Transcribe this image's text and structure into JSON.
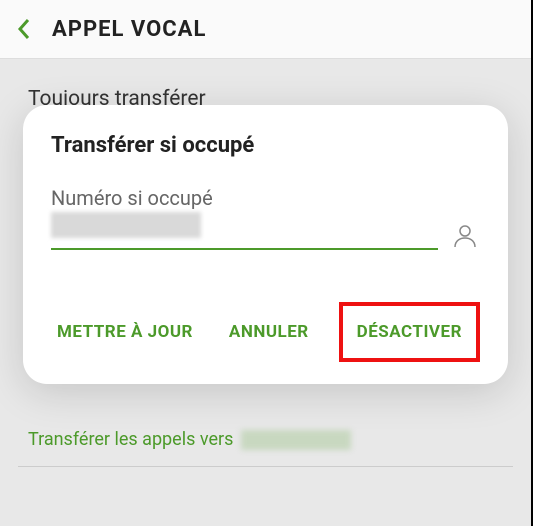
{
  "header": {
    "title": "APPEL VOCAL"
  },
  "background": {
    "always_forward_label": "Toujours transférer",
    "forward_calls_to_label": "Transférer les appels vers"
  },
  "dialog": {
    "title": "Transférer si occupé",
    "field_label": "Numéro si occupé",
    "number_value": "",
    "buttons": {
      "update": "METTRE À JOUR",
      "cancel": "ANNULER",
      "deactivate": "DÉSACTIVER"
    }
  },
  "colors": {
    "accent": "#4c9a2a",
    "highlight": "#e11"
  }
}
